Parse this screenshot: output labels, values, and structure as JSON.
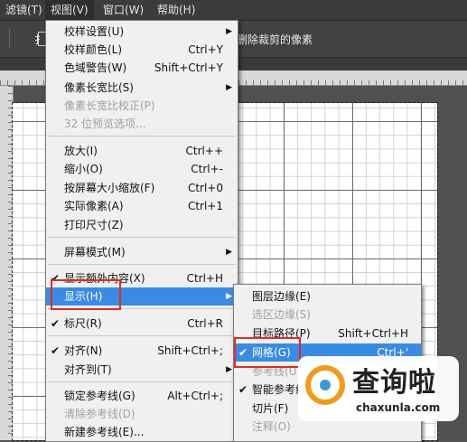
{
  "menubar": {
    "items": [
      {
        "label": "滤镜(T)"
      },
      {
        "label": "视图(V)"
      },
      {
        "label": "窗口(W)"
      },
      {
        "label": "帮助(H)"
      }
    ]
  },
  "optbar": {
    "text": "删除裁剪的像素",
    "text_prefix": "扌"
  },
  "view_menu": {
    "items": [
      {
        "label": "校样设置(U)",
        "shortcut": "",
        "submenu": true
      },
      {
        "label": "校样颜色(L)",
        "shortcut": "Ctrl+Y"
      },
      {
        "label": "色域警告(W)",
        "shortcut": "Shift+Ctrl+Y"
      },
      {
        "label": "像素长宽比(S)",
        "shortcut": "",
        "submenu": true
      },
      {
        "label": "像素长宽比校正(P)",
        "shortcut": "",
        "disabled": true
      },
      {
        "label": "32 位预览选项...",
        "shortcut": "",
        "disabled": true
      },
      {
        "label": "放大(I)",
        "shortcut": "Ctrl++"
      },
      {
        "label": "缩小(O)",
        "shortcut": "Ctrl+-"
      },
      {
        "label": "按屏幕大小缩放(F)",
        "shortcut": "Ctrl+0"
      },
      {
        "label": "实际像素(A)",
        "shortcut": "Ctrl+1"
      },
      {
        "label": "打印尺寸(Z)",
        "shortcut": ""
      },
      {
        "label": "屏幕模式(M)",
        "shortcut": "",
        "submenu": true
      },
      {
        "label": "显示额外内容(X)",
        "shortcut": "Ctrl+H",
        "checked": true
      },
      {
        "label": "显示(H)",
        "shortcut": "",
        "submenu": true,
        "highlighted": true
      },
      {
        "label": "标尺(R)",
        "shortcut": "Ctrl+R",
        "checked": true
      },
      {
        "label": "对齐(N)",
        "shortcut": "Shift+Ctrl+;",
        "checked": true
      },
      {
        "label": "对齐到(T)",
        "shortcut": "",
        "submenu": true
      },
      {
        "label": "锁定参考线(G)",
        "shortcut": "Alt+Ctrl+;"
      },
      {
        "label": "清除参考线(D)",
        "shortcut": "",
        "disabled": true
      },
      {
        "label": "新建参考线(E)...",
        "shortcut": ""
      }
    ]
  },
  "show_submenu": {
    "items": [
      {
        "label": "图层边缘(E)",
        "shortcut": ""
      },
      {
        "label": "选区边缘(S)",
        "shortcut": "",
        "disabled": true
      },
      {
        "label": "目标路径(P)",
        "shortcut": "Shift+Ctrl+H"
      },
      {
        "label": "网格(G)",
        "shortcut": "Ctrl+'",
        "checked": true,
        "highlighted": true
      },
      {
        "label": "参考线(U)",
        "shortcut": "",
        "disabled": true
      },
      {
        "label": "智能参考线",
        "shortcut": "",
        "checked": true
      },
      {
        "label": "切片(F)",
        "shortcut": ""
      },
      {
        "label": "注释(O)",
        "shortcut": "",
        "disabled": true
      }
    ]
  },
  "watermark": {
    "title": "查询啦",
    "subtitle": "chaxunla.com"
  },
  "colors": {
    "highlight": "#3a8be2",
    "annotation_box": "#e02a2a",
    "logo_orange": "#f29a1e",
    "logo_blue": "#3a9ad9"
  }
}
